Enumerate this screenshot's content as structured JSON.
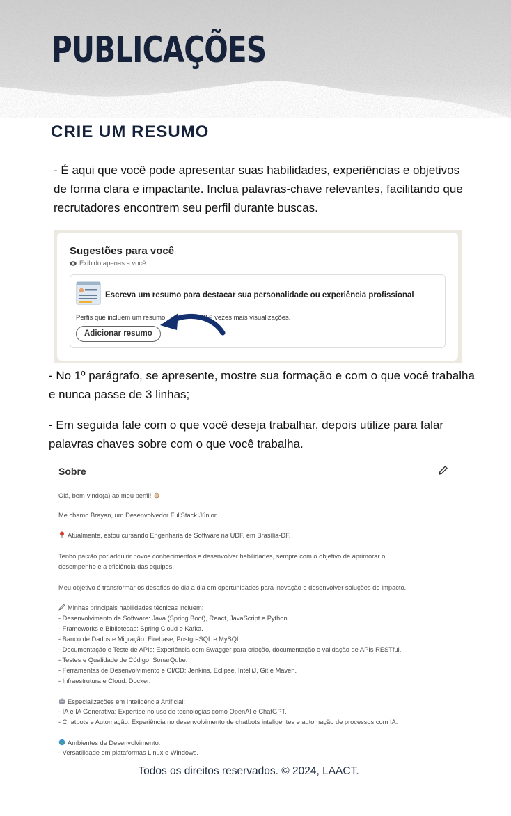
{
  "header": {
    "title": "PUBLICAÇÕES"
  },
  "section": {
    "heading": "CRIE UM RESUMO"
  },
  "intro": {
    "paragraph_1": "- É aqui que você pode apresentar suas habilidades, experiências e objetivos de forma clara e impactante. Inclua palavras-chave relevantes, facilitando que recrutadores encontrem seu perfil durante buscas.",
    "paragraph_2": "- No 1º parágrafo, se apresente, mostre sua formação e com o que você trabalha e nunca passe de 3 linhas;",
    "paragraph_3": "- Em seguida fale com o que você deseja trabalhar, depois utilize para falar palavras chaves sobre com o que você trabalha."
  },
  "suggestions": {
    "title": "Sugestões para você",
    "subtitle": "Exibido apenas a você",
    "card_title": "Escreva um resumo para destacar sua personalidade ou experiência profissional",
    "card_note_start": "Perfis que incluem um resumo",
    "card_note_end": "3,9 vezes mais visualizações.",
    "button_label": "Adicionar resumo"
  },
  "about": {
    "title": "Sobre",
    "lines": [
      "Olá, bem-vindo(a) ao meu perfil!",
      "Me chamo Brayan, um Desenvolvedor FullStack Júnior.",
      "Atualmente, estou cursando Engenharia de Software na UDF, em Brasília-DF.",
      "Tenho paixão por adquirir novos conhecimentos e desenvolver habilidades, sempre com o objetivo de aprimorar o",
      "desempenho e a eficiência das equipes.",
      "Meu objetivo é transformar os desafios do dia a dia em oportunidades para inovação e desenvolver soluções de impacto.",
      "Minhas principais habilidades técnicas incluem:",
      "- Desenvolvimento de Software: Java (Spring Boot), React, JavaScript e Python.",
      "- Frameworks e Bibliotecas: Spring Cloud e Kafka.",
      "- Banco de Dados e Migração: Firebase, PostgreSQL e MySQL.",
      "- Documentação e Teste de APIs: Experiência com Swagger para criação, documentação e validação de APIs RESTful.",
      "- Testes e Qualidade de Código: SonarQube.",
      "- Ferramentas de Desenvolvimento e CI/CD: Jenkins, Eclipse, IntelliJ, Git e Maven.",
      "- Infraestrutura e Cloud: Docker.",
      "Especializações em Inteligência Artificial:",
      "- IA e IA Generativa: Expertise no uso de tecnologias como OpenAI e ChatGPT.",
      "- Chatbots e Automação: Experiência no desenvolvimento de chatbots inteligentes e automação de processos com IA.",
      "Ambientes de Desenvolvimento:",
      "- Versatilidade em plataformas Linux e Windows."
    ]
  },
  "footer": {
    "text": "Todos os direitos reservados. © 2024, LAACT."
  },
  "colors": {
    "title_navy": "#16223a",
    "arrow_navy": "#14306e",
    "texture_gray": "#c9c9c9"
  }
}
